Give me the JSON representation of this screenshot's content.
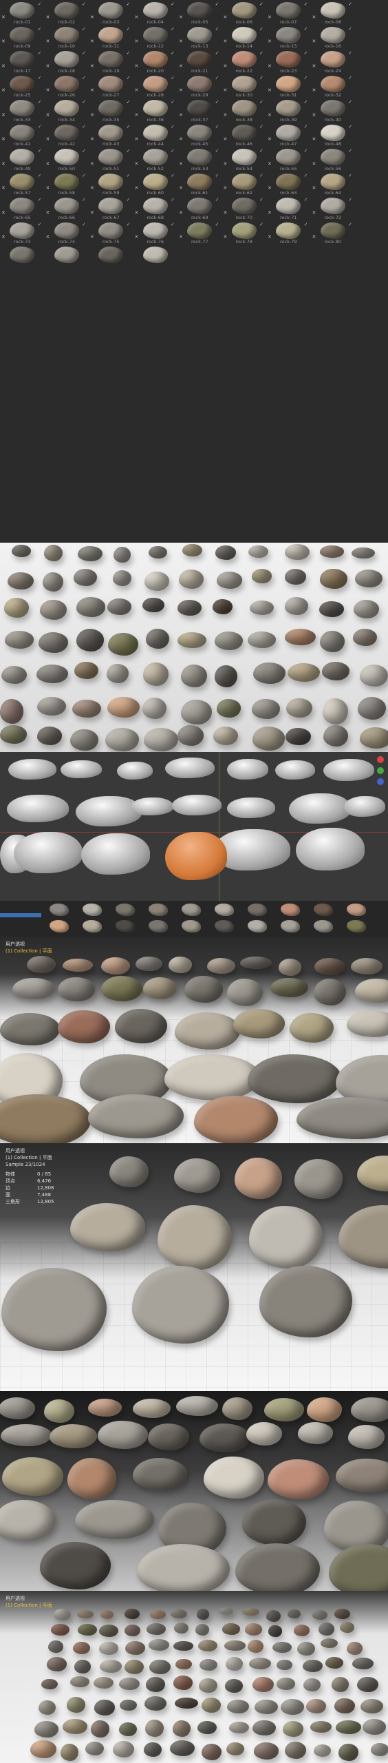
{
  "asset_browser": {
    "labels": [
      "rock-01",
      "rock-02",
      "rock-03",
      "rock-04",
      "rock-05",
      "rock-06",
      "rock-07",
      "rock-08",
      "rock-09",
      "rock-10",
      "rock-11",
      "rock-12",
      "rock-13",
      "rock-14",
      "rock-15",
      "rock-16",
      "rock-17",
      "rock-18",
      "rock-19",
      "rock-20",
      "rock-21",
      "rock-22",
      "rock-23",
      "rock-24",
      "rock-25",
      "rock-26",
      "rock-27",
      "rock-28",
      "rock-29",
      "rock-30",
      "rock-31",
      "rock-32",
      "rock-33",
      "rock-34",
      "rock-35",
      "rock-36",
      "rock-37",
      "rock-38",
      "rock-39",
      "rock-40",
      "rock-41",
      "rock-42",
      "rock-43",
      "rock-44",
      "rock-45",
      "rock-46",
      "rock-47",
      "rock-48",
      "rock-49",
      "rock-50",
      "rock-51",
      "rock-52",
      "rock-53",
      "rock-54",
      "rock-55",
      "rock-56",
      "rock-57",
      "rock-58",
      "rock-59",
      "rock-60",
      "rock-61",
      "rock-62",
      "rock-63",
      "rock-64",
      "rock-65",
      "rock-66",
      "rock-67",
      "rock-68",
      "rock-69",
      "rock-70",
      "rock-71",
      "rock-72",
      "rock-73",
      "rock-74",
      "rock-75",
      "rock-76",
      "rock-77",
      "rock-78",
      "rock-79",
      "rock-80"
    ],
    "rock_colors": [
      "#8d8a84",
      "#6e6a63",
      "#9c9890",
      "#b8b4ac",
      "#595550",
      "#a49880",
      "#7b776f",
      "#c9c2b6",
      "#6a655e",
      "#8e8377",
      "#c1a58f",
      "#747069",
      "#9f9a92",
      "#d0c9bd",
      "#8a8680",
      "#b3ada3",
      "#5c5853",
      "#a6a199",
      "#787068",
      "#b2876c",
      "#5a4a3f",
      "#c08d79",
      "#9a6c5a",
      "#c7a189",
      "#6e5a4c",
      "#8c7668",
      "#a18b7c",
      "#c39d84",
      "#8d7a70",
      "#b0a292",
      "#d1a685",
      "#b58a70",
      "#8f8b83",
      "#b6ad9d",
      "#6f6b64",
      "#c2b8a5",
      "#4f4b46",
      "#9e9484",
      "#a59c8b",
      "#7a7670",
      "#88837b",
      "#6c6760",
      "#a1998d",
      "#c3bdb0",
      "#8a857d",
      "#5f5b55",
      "#b0aba2",
      "#d8d2c6",
      "#b3aea6",
      "#c7c2b9",
      "#9a958d",
      "#a7a29a",
      "#7f7a73",
      "#c8c3ba",
      "#9d988f",
      "#8b877f",
      "#9a8f6d",
      "#7c7a55",
      "#b0a585",
      "#bcaf8d",
      "#8f7b5f",
      "#a89b7c",
      "#7e7357",
      "#b7a688",
      "#8c8780",
      "#9b968e",
      "#a8a39b",
      "#b8b3aa",
      "#7e7a73",
      "#6f6b64",
      "#c0bbb2",
      "#b0aba3",
      "#a7a29a",
      "#8f8a83",
      "#918c85",
      "#bdb8af",
      "#7d7d60",
      "#a3a07b",
      "#b6b190",
      "#6f6d55"
    ],
    "extra_row": [
      "#7a766e",
      "#a19c93",
      "#6a665f",
      "#c0bbb1"
    ]
  },
  "viewport_hud": {
    "title": "用户透视",
    "collection": "(1) Collection | 平面",
    "sample": "Sample 23/1024",
    "stats": [
      {
        "label": "物体",
        "value": "0 / 85"
      },
      {
        "label": "顶点",
        "value": "6,476"
      },
      {
        "label": "边",
        "value": "12,808"
      },
      {
        "label": "面",
        "value": "7,488"
      },
      {
        "label": "三角形",
        "value": "12,805"
      }
    ]
  },
  "colors": {
    "accent": "#f0c040",
    "axis_x": "#d44",
    "axis_y": "#4a4",
    "axis_z": "#46c",
    "selection": "#3d6fb3",
    "orange_highlight": "#d57a3a"
  }
}
